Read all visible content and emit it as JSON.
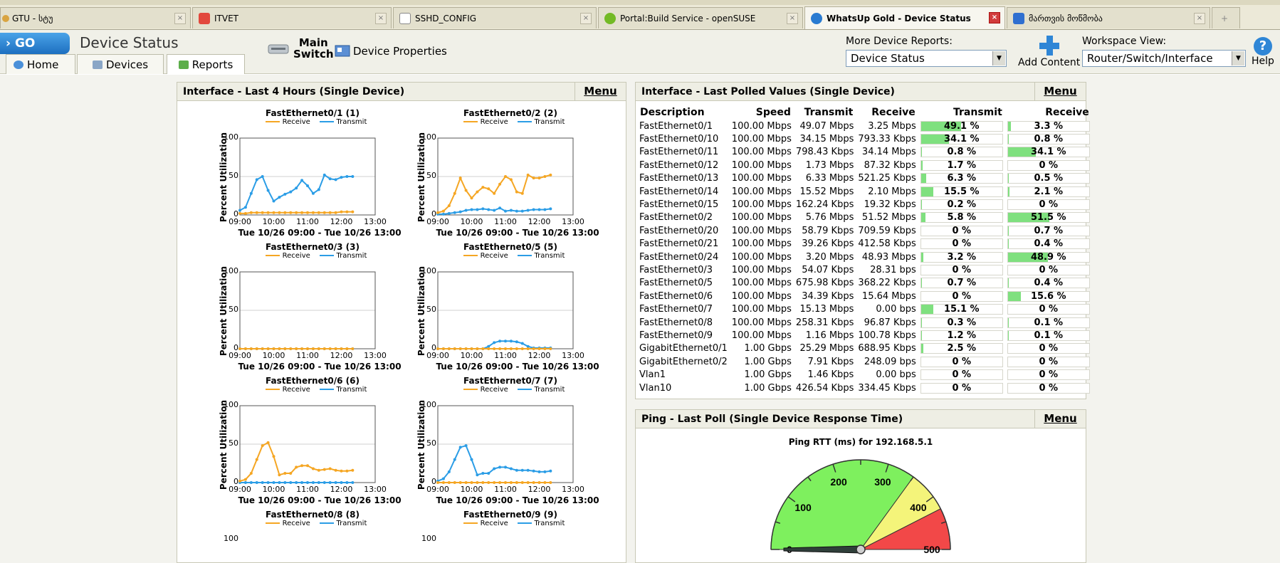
{
  "browser": {
    "tabs": [
      {
        "label": "GTU - სტუ",
        "icon": "earth-icon",
        "active": false
      },
      {
        "label": "ITVET",
        "icon": "people-icon",
        "active": false
      },
      {
        "label": "SSHD_CONFIG",
        "icon": "document-icon",
        "active": false
      },
      {
        "label": "Portal:Build Service - openSUSE",
        "icon": "opensuse-icon",
        "active": false
      },
      {
        "label": "WhatsUp Gold - Device Status",
        "icon": "whatsup-icon",
        "active": true
      },
      {
        "label": "მართვის მოწმობა",
        "icon": "car-icon",
        "active": false
      }
    ],
    "close_label": "×",
    "newtab_label": "+"
  },
  "header": {
    "go_label": "GO",
    "page_title": "Device Status",
    "tabs": {
      "home": "Home",
      "devices": "Devices",
      "reports": "Reports"
    },
    "device_name_line1": "Main",
    "device_name_line2": "Switch",
    "device_properties": "Device Properties",
    "more_reports_label": "More Device Reports:",
    "more_reports_value": "Device Status",
    "add_content": "Add Content",
    "workspace_label": "Workspace View:",
    "workspace_value": "Router/Switch/Interface",
    "help": "Help"
  },
  "charts_panel": {
    "title": "Interface - Last 4 Hours (Single Device)",
    "menu": "Menu",
    "legend_receive": "Receive",
    "legend_transmit": "Transmit",
    "colors": {
      "receive": "#f5a623",
      "transmit": "#2b9de6"
    }
  },
  "chart_data": [
    {
      "type": "line",
      "title": "FastEthernet0/1 (1)",
      "ylabel": "Percent Utilization",
      "xlabel": "Tue 10/26 09:00 - Tue 10/26 13:00",
      "ylim": [
        0,
        100
      ],
      "yticks": [
        "0",
        "50",
        "100"
      ],
      "xticks": [
        "09:00",
        "10:00",
        "11:00",
        "12:00",
        "13:00"
      ],
      "x": [
        "09:00",
        "09:10",
        "09:20",
        "09:30",
        "09:40",
        "09:50",
        "10:00",
        "10:10",
        "10:20",
        "10:30",
        "10:40",
        "10:50",
        "11:00",
        "11:10",
        "11:20",
        "11:30",
        "11:40",
        "11:50",
        "12:00",
        "12:10",
        "12:20"
      ],
      "series": [
        {
          "name": "Receive",
          "values": [
            2,
            2,
            3,
            3,
            3,
            3,
            3,
            3,
            3,
            3,
            3,
            3,
            3,
            3,
            3,
            3,
            3,
            3,
            4,
            4,
            4
          ]
        },
        {
          "name": "Transmit",
          "values": [
            6,
            10,
            28,
            46,
            50,
            32,
            18,
            23,
            27,
            30,
            35,
            45,
            38,
            28,
            33,
            52,
            47,
            46,
            49,
            50,
            50
          ]
        }
      ]
    },
    {
      "type": "line",
      "title": "FastEthernet0/2 (2)",
      "ylabel": "Percent Utilization",
      "xlabel": "Tue 10/26 09:00 - Tue 10/26 13:00",
      "ylim": [
        0,
        100
      ],
      "yticks": [
        "0",
        "50",
        "100"
      ],
      "xticks": [
        "09:00",
        "10:00",
        "11:00",
        "12:00",
        "13:00"
      ],
      "x": [
        "09:00",
        "09:10",
        "09:20",
        "09:30",
        "09:40",
        "09:50",
        "10:00",
        "10:10",
        "10:20",
        "10:30",
        "10:40",
        "10:50",
        "11:00",
        "11:10",
        "11:20",
        "11:30",
        "11:40",
        "11:50",
        "12:00",
        "12:10",
        "12:20"
      ],
      "series": [
        {
          "name": "Receive",
          "values": [
            3,
            5,
            12,
            28,
            48,
            32,
            22,
            30,
            36,
            34,
            28,
            40,
            50,
            46,
            30,
            28,
            52,
            48,
            48,
            50,
            52
          ]
        },
        {
          "name": "Transmit",
          "values": [
            1,
            1,
            2,
            3,
            4,
            6,
            7,
            7,
            8,
            7,
            6,
            9,
            5,
            6,
            5,
            5,
            6,
            7,
            7,
            7,
            8
          ]
        }
      ]
    },
    {
      "type": "line",
      "title": "FastEthernet0/3 (3)",
      "ylabel": "Percent Utilization",
      "xlabel": "Tue 10/26 09:00 - Tue 10/26 13:00",
      "ylim": [
        0,
        100
      ],
      "yticks": [
        "0",
        "50",
        "100"
      ],
      "xticks": [
        "09:00",
        "10:00",
        "11:00",
        "12:00",
        "13:00"
      ],
      "x": [
        "09:00",
        "09:10",
        "09:20",
        "09:30",
        "09:40",
        "09:50",
        "10:00",
        "10:10",
        "10:20",
        "10:30",
        "10:40",
        "10:50",
        "11:00",
        "11:10",
        "11:20",
        "11:30",
        "11:40",
        "11:50",
        "12:00",
        "12:10",
        "12:20"
      ],
      "series": [
        {
          "name": "Receive",
          "values": [
            0,
            0,
            0,
            0,
            0,
            0,
            0,
            0,
            0,
            0,
            0,
            0,
            0,
            0,
            0,
            0,
            0,
            0,
            0,
            0,
            0
          ]
        },
        {
          "name": "Transmit",
          "values": [
            0,
            0,
            0,
            0,
            0,
            0,
            0,
            0,
            0,
            0,
            0,
            0,
            0,
            0,
            0,
            0,
            0,
            0,
            0,
            0,
            0
          ]
        }
      ]
    },
    {
      "type": "line",
      "title": "FastEthernet0/5 (5)",
      "ylabel": "Percent Utilization",
      "xlabel": "Tue 10/26 09:00 - Tue 10/26 13:00",
      "ylim": [
        0,
        100
      ],
      "yticks": [
        "0",
        "50",
        "100"
      ],
      "xticks": [
        "09:00",
        "10:00",
        "11:00",
        "12:00",
        "13:00"
      ],
      "x": [
        "09:00",
        "09:10",
        "09:20",
        "09:30",
        "09:40",
        "09:50",
        "10:00",
        "10:10",
        "10:20",
        "10:30",
        "10:40",
        "10:50",
        "11:00",
        "11:10",
        "11:20",
        "11:30",
        "11:40",
        "11:50",
        "12:00",
        "12:10",
        "12:20"
      ],
      "series": [
        {
          "name": "Receive",
          "values": [
            0,
            0,
            0,
            0,
            0,
            0,
            0,
            0,
            0,
            0,
            0,
            0,
            0,
            0,
            0,
            0,
            0,
            0,
            0,
            0,
            0
          ]
        },
        {
          "name": "Transmit",
          "values": [
            0,
            0,
            0,
            0,
            0,
            0,
            0,
            0,
            0,
            3,
            8,
            10,
            10,
            10,
            9,
            7,
            3,
            1,
            1,
            1,
            1
          ]
        }
      ]
    },
    {
      "type": "line",
      "title": "FastEthernet0/6 (6)",
      "ylabel": "Percent Utilization",
      "xlabel": "Tue 10/26 09:00 - Tue 10/26 13:00",
      "ylim": [
        0,
        100
      ],
      "yticks": [
        "0",
        "50",
        "100"
      ],
      "xticks": [
        "09:00",
        "10:00",
        "11:00",
        "12:00",
        "13:00"
      ],
      "x": [
        "09:00",
        "09:10",
        "09:20",
        "09:30",
        "09:40",
        "09:50",
        "10:00",
        "10:10",
        "10:20",
        "10:30",
        "10:40",
        "10:50",
        "11:00",
        "11:10",
        "11:20",
        "11:30",
        "11:40",
        "11:50",
        "12:00",
        "12:10",
        "12:20"
      ],
      "series": [
        {
          "name": "Receive",
          "values": [
            2,
            4,
            12,
            30,
            48,
            52,
            34,
            10,
            12,
            12,
            20,
            22,
            22,
            18,
            16,
            17,
            18,
            16,
            15,
            15,
            16
          ]
        },
        {
          "name": "Transmit",
          "values": [
            0,
            0,
            0,
            0,
            0,
            0,
            0,
            0,
            0,
            0,
            0,
            0,
            0,
            0,
            0,
            0,
            0,
            0,
            0,
            0,
            0
          ]
        }
      ]
    },
    {
      "type": "line",
      "title": "FastEthernet0/7 (7)",
      "ylabel": "Percent Utilization",
      "xlabel": "Tue 10/26 09:00 - Tue 10/26 13:00",
      "ylim": [
        0,
        100
      ],
      "yticks": [
        "0",
        "50",
        "100"
      ],
      "xticks": [
        "09:00",
        "10:00",
        "11:00",
        "12:00",
        "13:00"
      ],
      "x": [
        "09:00",
        "09:10",
        "09:20",
        "09:30",
        "09:40",
        "09:50",
        "10:00",
        "10:10",
        "10:20",
        "10:30",
        "10:40",
        "10:50",
        "11:00",
        "11:10",
        "11:20",
        "11:30",
        "11:40",
        "11:50",
        "12:00",
        "12:10",
        "12:20"
      ],
      "series": [
        {
          "name": "Receive",
          "values": [
            0,
            0,
            0,
            0,
            0,
            0,
            0,
            0,
            0,
            0,
            0,
            0,
            0,
            0,
            0,
            0,
            0,
            0,
            0,
            0,
            0
          ]
        },
        {
          "name": "Transmit",
          "values": [
            2,
            5,
            14,
            30,
            46,
            48,
            30,
            10,
            12,
            12,
            18,
            20,
            20,
            18,
            16,
            16,
            16,
            15,
            14,
            14,
            15
          ]
        }
      ]
    }
  ],
  "extra_chart_titles": [
    "FastEthernet0/8 (8)",
    "FastEthernet0/9 (9)"
  ],
  "extra_chart_first_ytick": "100",
  "table_panel": {
    "title": "Interface - Last Polled Values (Single Device)",
    "menu": "Menu",
    "headers": {
      "description": "Description",
      "speed": "Speed",
      "transmit": "Transmit",
      "receive": "Receive",
      "transmit_pct": "Transmit",
      "receive_pct": "Receive"
    },
    "rows": [
      {
        "desc": "FastEthernet0/1",
        "speed": "100.00 Mbps",
        "tx": "49.07 Mbps",
        "rx": "3.25 Mbps",
        "txp": 49.1,
        "rxp": 3.3,
        "txl": "49.1 %",
        "rxl": "3.3 %"
      },
      {
        "desc": "FastEthernet0/10",
        "speed": "100.00 Mbps",
        "tx": "34.15 Mbps",
        "rx": "793.33 Kbps",
        "txp": 34.1,
        "rxp": 0.8,
        "txl": "34.1 %",
        "rxl": "0.8 %"
      },
      {
        "desc": "FastEthernet0/11",
        "speed": "100.00 Mbps",
        "tx": "798.43 Kbps",
        "rx": "34.14 Mbps",
        "txp": 0.8,
        "rxp": 34.1,
        "txl": "0.8 %",
        "rxl": "34.1 %"
      },
      {
        "desc": "FastEthernet0/12",
        "speed": "100.00 Mbps",
        "tx": "1.73 Mbps",
        "rx": "87.32 Kbps",
        "txp": 1.7,
        "rxp": 0,
        "txl": "1.7 %",
        "rxl": "0 %"
      },
      {
        "desc": "FastEthernet0/13",
        "speed": "100.00 Mbps",
        "tx": "6.33 Mbps",
        "rx": "521.25 Kbps",
        "txp": 6.3,
        "rxp": 0.5,
        "txl": "6.3 %",
        "rxl": "0.5 %"
      },
      {
        "desc": "FastEthernet0/14",
        "speed": "100.00 Mbps",
        "tx": "15.52 Mbps",
        "rx": "2.10 Mbps",
        "txp": 15.5,
        "rxp": 2.1,
        "txl": "15.5 %",
        "rxl": "2.1 %"
      },
      {
        "desc": "FastEthernet0/15",
        "speed": "100.00 Mbps",
        "tx": "162.24 Kbps",
        "rx": "19.32 Kbps",
        "txp": 0.2,
        "rxp": 0,
        "txl": "0.2 %",
        "rxl": "0 %"
      },
      {
        "desc": "FastEthernet0/2",
        "speed": "100.00 Mbps",
        "tx": "5.76 Mbps",
        "rx": "51.52 Mbps",
        "txp": 5.8,
        "rxp": 51.5,
        "txl": "5.8 %",
        "rxl": "51.5 %"
      },
      {
        "desc": "FastEthernet0/20",
        "speed": "100.00 Mbps",
        "tx": "58.79 Kbps",
        "rx": "709.59 Kbps",
        "txp": 0,
        "rxp": 0.7,
        "txl": "0 %",
        "rxl": "0.7 %"
      },
      {
        "desc": "FastEthernet0/21",
        "speed": "100.00 Mbps",
        "tx": "39.26 Kbps",
        "rx": "412.58 Kbps",
        "txp": 0,
        "rxp": 0.4,
        "txl": "0 %",
        "rxl": "0.4 %"
      },
      {
        "desc": "FastEthernet0/24",
        "speed": "100.00 Mbps",
        "tx": "3.20 Mbps",
        "rx": "48.93 Mbps",
        "txp": 3.2,
        "rxp": 48.9,
        "txl": "3.2 %",
        "rxl": "48.9 %"
      },
      {
        "desc": "FastEthernet0/3",
        "speed": "100.00 Mbps",
        "tx": "54.07 Kbps",
        "rx": "28.31 bps",
        "txp": 0,
        "rxp": 0,
        "txl": "0 %",
        "rxl": "0 %"
      },
      {
        "desc": "FastEthernet0/5",
        "speed": "100.00 Mbps",
        "tx": "675.98 Kbps",
        "rx": "368.22 Kbps",
        "txp": 0.7,
        "rxp": 0.4,
        "txl": "0.7 %",
        "rxl": "0.4 %"
      },
      {
        "desc": "FastEthernet0/6",
        "speed": "100.00 Mbps",
        "tx": "34.39 Kbps",
        "rx": "15.64 Mbps",
        "txp": 0,
        "rxp": 15.6,
        "txl": "0 %",
        "rxl": "15.6 %"
      },
      {
        "desc": "FastEthernet0/7",
        "speed": "100.00 Mbps",
        "tx": "15.13 Mbps",
        "rx": "0.00 bps",
        "txp": 15.1,
        "rxp": 0,
        "txl": "15.1 %",
        "rxl": "0 %"
      },
      {
        "desc": "FastEthernet0/8",
        "speed": "100.00 Mbps",
        "tx": "258.31 Kbps",
        "rx": "96.87 Kbps",
        "txp": 0.3,
        "rxp": 0.1,
        "txl": "0.3 %",
        "rxl": "0.1 %"
      },
      {
        "desc": "FastEthernet0/9",
        "speed": "100.00 Mbps",
        "tx": "1.16 Mbps",
        "rx": "100.78 Kbps",
        "txp": 1.2,
        "rxp": 0.1,
        "txl": "1.2 %",
        "rxl": "0.1 %"
      },
      {
        "desc": "GigabitEthernet0/1",
        "speed": "1.00 Gbps",
        "tx": "25.29 Mbps",
        "rx": "688.95 Kbps",
        "txp": 2.5,
        "rxp": 0,
        "txl": "2.5 %",
        "rxl": "0 %"
      },
      {
        "desc": "GigabitEthernet0/2",
        "speed": "1.00 Gbps",
        "tx": "7.91 Kbps",
        "rx": "248.09 bps",
        "txp": 0,
        "rxp": 0,
        "txl": "0 %",
        "rxl": "0 %"
      },
      {
        "desc": "Vlan1",
        "speed": "1.00 Gbps",
        "tx": "1.46 Kbps",
        "rx": "0.00 bps",
        "txp": 0,
        "rxp": 0,
        "txl": "0 %",
        "rxl": "0 %"
      },
      {
        "desc": "Vlan10",
        "speed": "1.00 Gbps",
        "tx": "426.54 Kbps",
        "rx": "334.45 Kbps",
        "txp": 0,
        "rxp": 0,
        "txl": "0 %",
        "rxl": "0 %"
      }
    ],
    "bar_color": "#7fe07f"
  },
  "ping_panel": {
    "title": "Ping - Last Poll (Single Device Response Time)",
    "menu": "Menu",
    "gauge_title": "Ping RTT (ms) for 192.168.5.1",
    "gauge_labels": [
      "0",
      "100",
      "200",
      "300",
      "400",
      "500"
    ],
    "gauge_value": 0,
    "gauge_max": 500,
    "zones": [
      {
        "from": 0,
        "to": 350,
        "color": "#7ef05e"
      },
      {
        "from": 350,
        "to": 425,
        "color": "#f4f47a"
      },
      {
        "from": 425,
        "to": 500,
        "color": "#f24848"
      }
    ]
  }
}
